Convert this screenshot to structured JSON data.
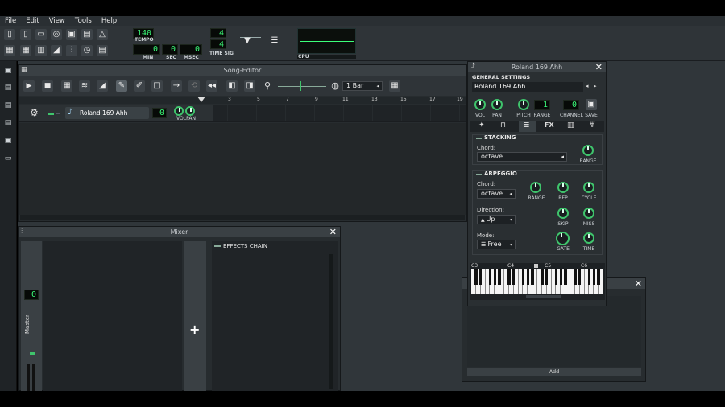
{
  "menu": [
    "File",
    "Edit",
    "View",
    "Tools",
    "Help"
  ],
  "transport": {
    "tempo_value": "140",
    "tempo_label": "TEMPO",
    "min_value": "0",
    "min_label": "MIN",
    "sec_value": "0",
    "sec_label": "SEC",
    "msec_value": "0",
    "msec_label": "MSEC",
    "timesig_num": "4",
    "timesig_den": "4",
    "timesig_label": "TIME SIG",
    "cpu_label": "CPU"
  },
  "song_editor": {
    "title": "Song-Editor",
    "quantize": "1 Bar",
    "ruler": [
      "3",
      "5",
      "7",
      "9",
      "11",
      "13",
      "15",
      "17",
      "19"
    ],
    "track_name": "Roland 169 Ahh",
    "track_lcd": "0",
    "track_knob_label": "VOLPAN"
  },
  "mixer": {
    "title": "Mixer",
    "effects_label": "EFFECTS CHAIN",
    "master_label": "Master",
    "master_lcd": "0",
    "add_symbol": "+"
  },
  "instrument": {
    "title": "Roland 169 Ahh",
    "general_settings": "GENERAL SETTINGS",
    "name": "Roland 169 Ahh",
    "knob_labels": [
      "VOL",
      "PAN",
      "PITCH",
      "RANGE",
      "CHANNEL",
      "SAVE"
    ],
    "pitch_lcd": "1",
    "channel_lcd": "0",
    "tabs": [
      "FX"
    ],
    "stacking": {
      "header": "STACKING",
      "chord_label": "Chord:",
      "chord_value": "octave",
      "range_label": "RANGE"
    },
    "arpeggio": {
      "header": "ARPEGGIO",
      "chord_label": "Chord:",
      "chord_value": "octave",
      "knob_labels": [
        "RANGE",
        "REP",
        "CYCLE",
        "SKIP",
        "MISS",
        "GATE",
        "TIME"
      ],
      "direction_label": "Direction:",
      "direction_value": "Up",
      "mode_label": "Mode:",
      "mode_value": "Free"
    },
    "piano_labels": [
      "C3",
      "C4",
      "C5",
      "C6"
    ]
  },
  "fx_window": {
    "add_label": "Add"
  }
}
